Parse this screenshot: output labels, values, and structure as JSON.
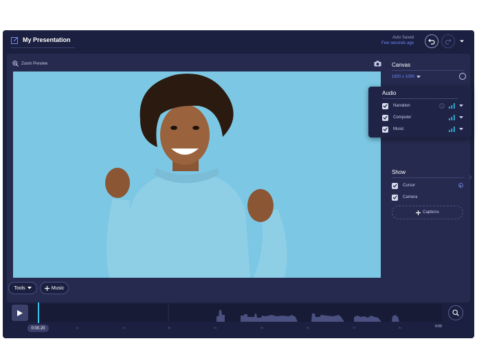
{
  "header": {
    "title": "My Presentation",
    "auto_saved": "Auto Saved",
    "saved_time": "Few seconds ago"
  },
  "preview": {
    "zoom_label": "Zoom Preview"
  },
  "side_panel": {
    "canvas_title": "Canvas",
    "resolution": "1920 x 1080",
    "audio": {
      "title": "Audio",
      "items": [
        {
          "label": "Narration",
          "checked": true
        },
        {
          "label": "Computer",
          "checked": true
        },
        {
          "label": "Music",
          "checked": true
        }
      ]
    },
    "show": {
      "title": "Show",
      "items": [
        {
          "label": "Cursor",
          "checked": true
        },
        {
          "label": "Camera",
          "checked": true
        }
      ],
      "captions_label": "Captions"
    }
  },
  "bottom": {
    "tools_label": "Tools",
    "music_label": "Music",
    "current_time": "0:00.20",
    "end_time": "0:09",
    "ticks": [
      "1s",
      "2s",
      "3s",
      "4s",
      "5s",
      "6s",
      "7s",
      "8s"
    ]
  },
  "colors": {
    "app_bg": "#1c2040",
    "panel_bg": "#252a4e",
    "accent": "#3ac3e8",
    "link": "#6f89ff",
    "preview_bg": "#7cc8e4"
  }
}
